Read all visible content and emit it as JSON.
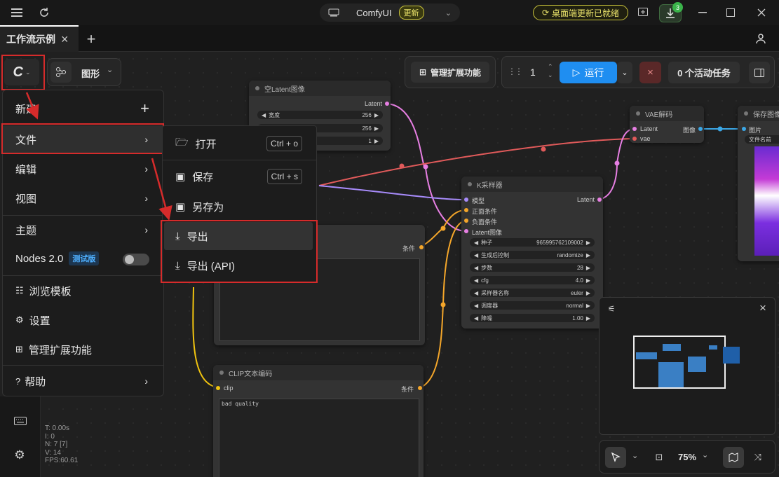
{
  "app": {
    "name": "ComfyUI",
    "new_badge": "更新",
    "update_notice": "桌面端更新已就绪",
    "download_count": "3"
  },
  "workflow_tab": {
    "label": "工作流示例"
  },
  "toolbar": {
    "graph_label": "图形",
    "manage_extensions": "管理扩展功能",
    "queue_count": "1",
    "run_label": "运行",
    "active_tasks": "0 个活动任务"
  },
  "menu": {
    "items": [
      {
        "label": "新建"
      },
      {
        "label": "文件"
      },
      {
        "label": "编辑"
      },
      {
        "label": "视图"
      },
      {
        "label": "主题"
      },
      {
        "label": "Nodes 2.0",
        "badge": "测试版"
      },
      {
        "label": "浏览模板"
      },
      {
        "label": "设置"
      },
      {
        "label": "管理扩展功能"
      },
      {
        "label": "帮助"
      }
    ]
  },
  "submenu": {
    "items": [
      {
        "label": "打开",
        "shortcut": "Ctrl + o"
      },
      {
        "label": "保存",
        "shortcut": "Ctrl + s"
      },
      {
        "label": "另存为"
      },
      {
        "label": "导出"
      },
      {
        "label": "导出 (API)"
      }
    ]
  },
  "nodes": {
    "empty_latent": {
      "title": "空Latent图像",
      "output": "Latent",
      "widgets": [
        {
          "name": "宽度",
          "value": "256"
        },
        {
          "name": "",
          "value": "256"
        },
        {
          "name": "",
          "value": "1"
        }
      ]
    },
    "vae_decode": {
      "title": "VAE解码",
      "in1": "Latent",
      "in2": "vae",
      "out": "图像"
    },
    "save_image": {
      "title": "保存图像",
      "in": "图片",
      "widget": "文件名前"
    },
    "ksampler": {
      "title": "K采样器",
      "inputs": [
        "模型",
        "正面条件",
        "负面条件",
        "Latent图像"
      ],
      "output": "Latent",
      "widgets": [
        {
          "name": "种子",
          "value": "965995762109002"
        },
        {
          "name": "生成后控制",
          "value": "randomize"
        },
        {
          "name": "步数",
          "value": "28"
        },
        {
          "name": "cfg",
          "value": "4.0"
        },
        {
          "name": "采样器名称",
          "value": "euler"
        },
        {
          "name": "调度器",
          "value": "normal"
        },
        {
          "name": "降噪",
          "value": "1.00"
        }
      ]
    },
    "clip_text_top": {
      "output": "条件"
    },
    "clip_text": {
      "title": "CLIP文本编码",
      "input": "clip",
      "output": "条件",
      "text": "bad quality"
    }
  },
  "stats": {
    "t": "T: 0.00s",
    "i": "I: 0",
    "n": "N: 7 [7]",
    "v": "V: 14",
    "fps": "FPS:60.61"
  },
  "zoom": "75%",
  "colors": {
    "accent_blue": "#1f8ef1",
    "highlight_red": "#d62b2b",
    "link_pink": "#e77fe3",
    "link_red": "#e05a5a",
    "link_purple": "#a78bfa",
    "link_orange": "#f4a62a",
    "link_yellow": "#f1c40f",
    "link_blue": "#3ba7e6"
  }
}
